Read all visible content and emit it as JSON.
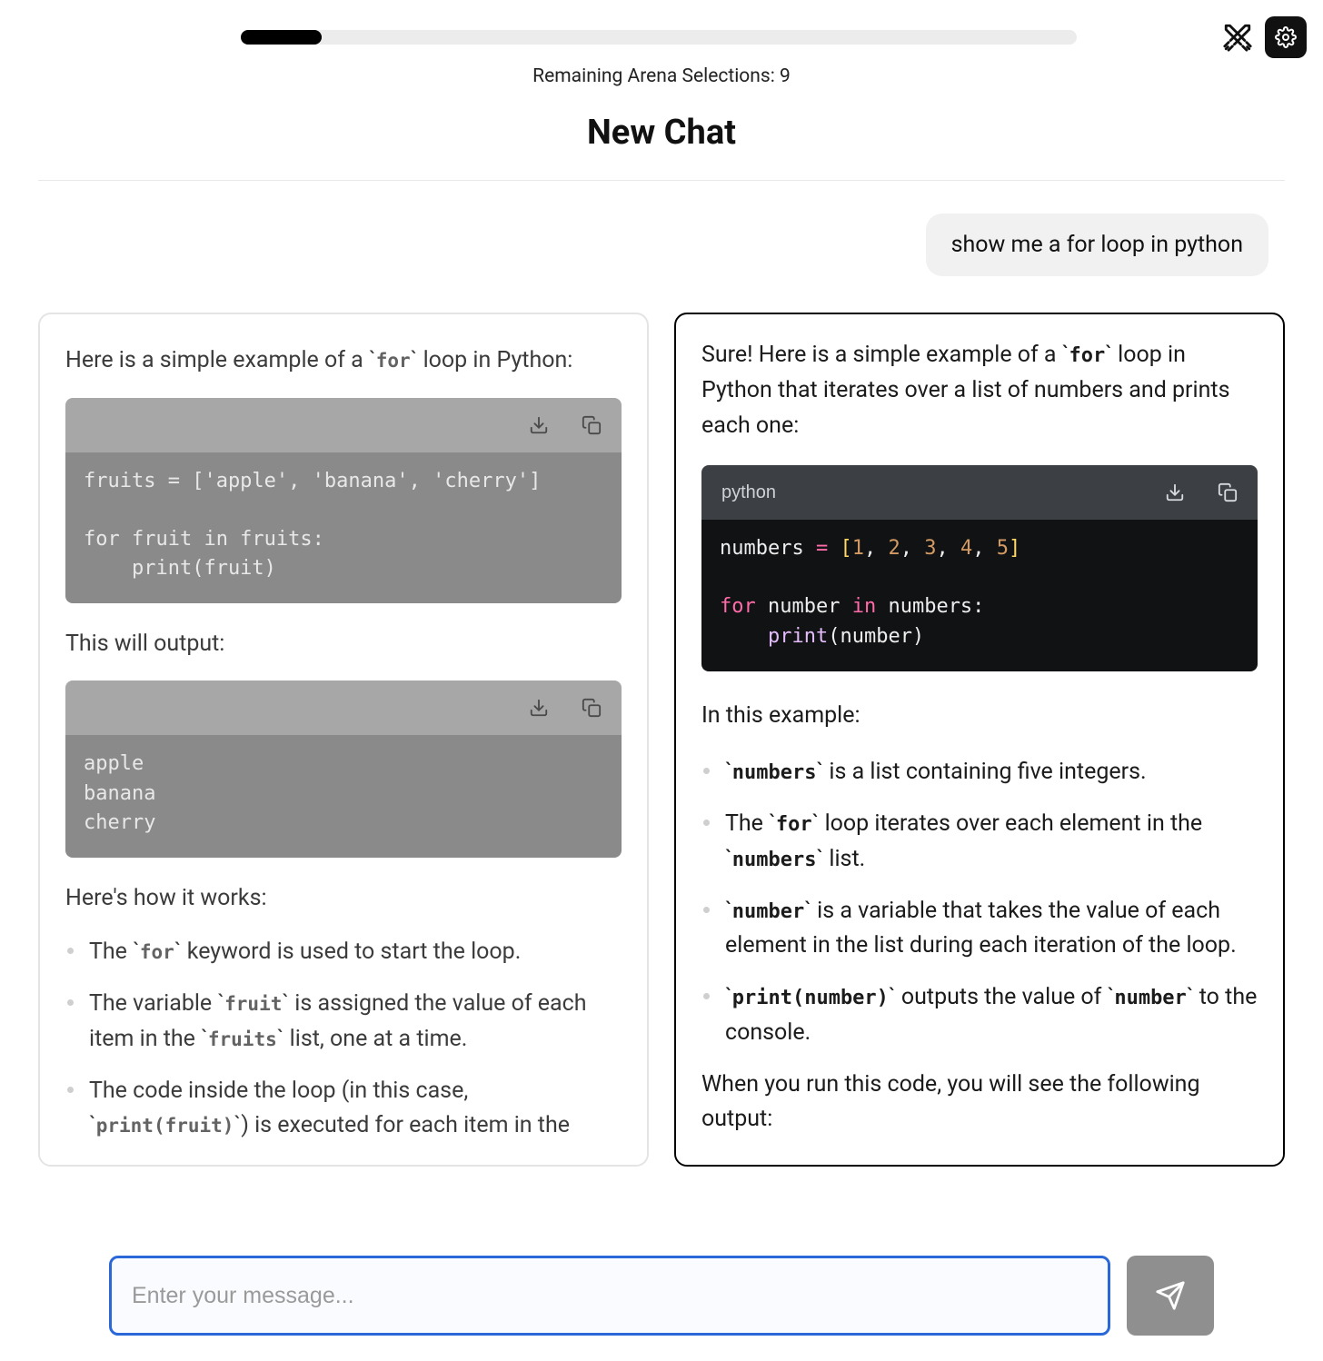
{
  "progress": {
    "percent": 9.7,
    "remaining_text": "Remaining Arena Selections: 9"
  },
  "title": "New Chat",
  "user_message": "show me a for loop in python",
  "left": {
    "intro_pre": "Here is a simple example of a ",
    "intro_code": "for",
    "intro_post": " loop in Python:",
    "code1": "fruits = ['apple', 'banana', 'cherry']\n\nfor fruit in fruits:\n    print(fruit)",
    "output_label": "This will output:",
    "code2": "apple\nbanana\ncherry",
    "how_label": "Here's how it works:",
    "b1_pre": "The ",
    "b1_code": "for",
    "b1_post": " keyword is used to start the loop.",
    "b2_pre": "The variable ",
    "b2_code": "fruit",
    "b2_mid": " is assigned the value of each item in the ",
    "b2_code2": "fruits",
    "b2_post": " list, one at a time.",
    "b3_pre": "The code inside the loop (in this case, ",
    "b3_code": "print(fruit)",
    "b3_post": ") is executed for each item in the"
  },
  "right": {
    "intro_pre": "Sure! Here is a simple example of a ",
    "intro_code": "for",
    "intro_post": " loop in Python that iterates over a list of numbers and prints each one:",
    "lang": "python",
    "code_plain": "numbers = [1, 2, 3, 4, 5]\n\nfor number in numbers:\n    print(number)",
    "example_label": "In this example:",
    "b1_code": "numbers",
    "b1_post": " is a list containing five integers.",
    "b2_pre": "The ",
    "b2_code": "for",
    "b2_mid": " loop iterates over each element in the ",
    "b2_code2": "numbers",
    "b2_post": " list.",
    "b3_code": "number",
    "b3_post": " is a variable that takes the value of each element in the list during each iteration of the loop.",
    "b4_code": "print(number)",
    "b4_mid": " outputs the value of ",
    "b4_code2": "number",
    "b4_post": " to the console.",
    "outro": "When you run this code, you will see the following output:"
  },
  "input": {
    "placeholder": "Enter your message..."
  }
}
